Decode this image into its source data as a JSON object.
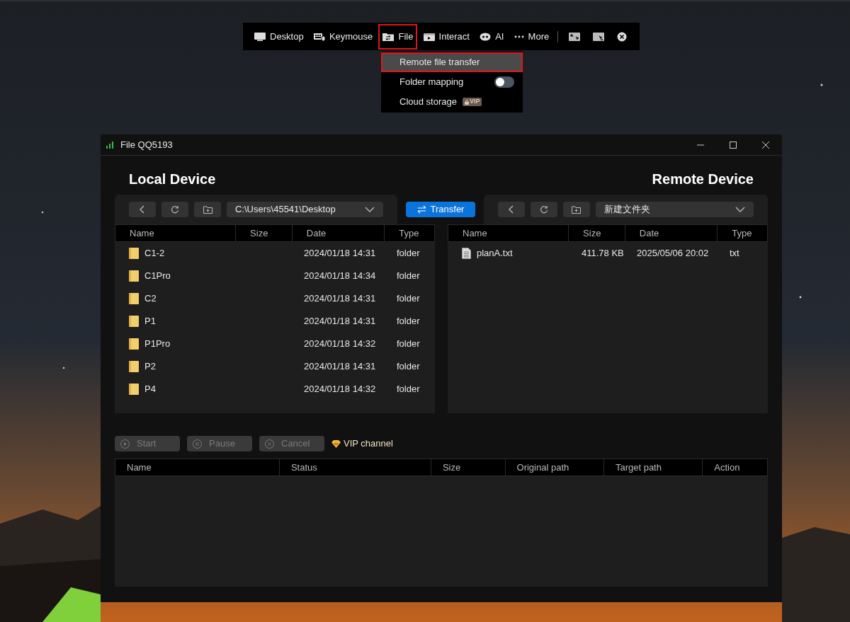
{
  "toolbar": {
    "items": [
      {
        "kind": "item",
        "label": "Desktop",
        "selected": false
      },
      {
        "kind": "item",
        "label": "Keymouse",
        "selected": false
      },
      {
        "kind": "item",
        "label": "File",
        "selected": true
      },
      {
        "kind": "item",
        "label": "Interact",
        "selected": false
      },
      {
        "kind": "item",
        "label": "AI",
        "selected": false
      },
      {
        "kind": "item",
        "label": "More",
        "selected": false
      },
      {
        "kind": "separator"
      },
      {
        "kind": "icon"
      },
      {
        "kind": "icon"
      },
      {
        "kind": "icon"
      }
    ]
  },
  "file_menu": {
    "items": [
      {
        "kind": "plain",
        "label": "Remote file transfer",
        "selected": true
      },
      {
        "kind": "toggle",
        "label": "Folder mapping",
        "selected": false,
        "on": false
      },
      {
        "kind": "badge",
        "label": "Cloud storage",
        "badge": "VIP",
        "selected": false
      }
    ]
  },
  "window": {
    "title": "File QQ5193",
    "local": {
      "heading": "Local Device",
      "path": "C:\\Users\\45541\\Desktop",
      "columns": [
        "Name",
        "Size",
        "Date",
        "Type"
      ],
      "rows": [
        {
          "name": "C1-2",
          "size": "",
          "date": "2024/01/18 14:31",
          "type": "folder"
        },
        {
          "name": "C1Pro",
          "size": "",
          "date": "2024/01/18 14:34",
          "type": "folder"
        },
        {
          "name": "C2",
          "size": "",
          "date": "2024/01/18 14:31",
          "type": "folder"
        },
        {
          "name": "P1",
          "size": "",
          "date": "2024/01/18 14:31",
          "type": "folder"
        },
        {
          "name": "P1Pro",
          "size": "",
          "date": "2024/01/18 14:32",
          "type": "folder"
        },
        {
          "name": "P2",
          "size": "",
          "date": "2024/01/18 14:31",
          "type": "folder"
        },
        {
          "name": "P4",
          "size": "",
          "date": "2024/01/18 14:32",
          "type": "folder"
        }
      ]
    },
    "transfer_button": "Transfer",
    "remote": {
      "heading": "Remote Device",
      "path": "新建文件夹",
      "columns": [
        "Name",
        "Size",
        "Date",
        "Type"
      ],
      "rows": [
        {
          "name": "planA.txt",
          "size": "411.78 KB",
          "date": "2025/05/06 20:02",
          "type": "txt"
        }
      ]
    },
    "actions": [
      {
        "label": "Start",
        "disabled": true
      },
      {
        "label": "Pause",
        "disabled": true
      },
      {
        "label": "Cancel",
        "disabled": true
      }
    ],
    "vip_channel": "VIP channel",
    "queue": {
      "columns": [
        "Name",
        "Status",
        "Size",
        "Original path",
        "Target path",
        "Action"
      ]
    }
  }
}
